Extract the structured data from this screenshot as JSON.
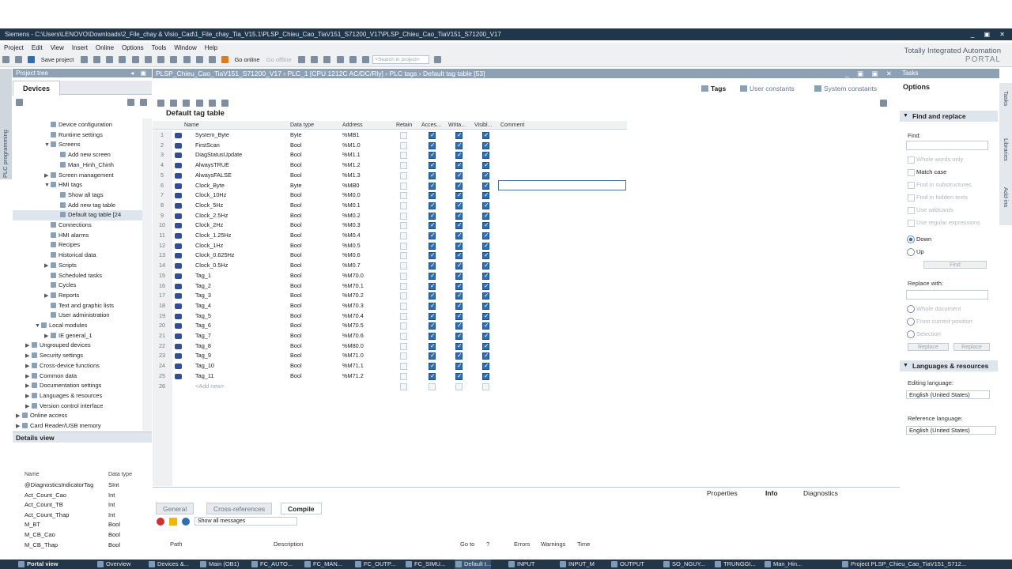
{
  "window": {
    "title": "Siemens  -  C:\\Users\\LENOVO\\Downloads\\2_File_chay & Visio_Cad\\1_File_chay_Tia_V15.1\\PLSP_Chieu_Cao_TiaV151_S71200_V17\\PLSP_Chieu_Cao_TiaV151_S71200_V17"
  },
  "menu": [
    "Project",
    "Edit",
    "View",
    "Insert",
    "Online",
    "Options",
    "Tools",
    "Window",
    "Help"
  ],
  "toolbar": {
    "save": "Save project",
    "go_online": "Go online",
    "go_offline": "Go offline",
    "search_placeholder": "<Search in project>"
  },
  "brand": {
    "line1": "Totally Integrated Automation",
    "line2": "PORTAL"
  },
  "project_tree": {
    "header": "Project tree",
    "tab": "Devices",
    "side_label": "PLC programming",
    "items": [
      {
        "label": "Device configuration",
        "indent": 3,
        "arrow": ""
      },
      {
        "label": "Runtime settings",
        "indent": 3,
        "arrow": ""
      },
      {
        "label": "Screens",
        "indent": 3,
        "arrow": "▼"
      },
      {
        "label": "Add new screen",
        "indent": 4,
        "arrow": ""
      },
      {
        "label": "Man_Hinh_Chinh",
        "indent": 4,
        "arrow": ""
      },
      {
        "label": "Screen management",
        "indent": 3,
        "arrow": "▶"
      },
      {
        "label": "HMI tags",
        "indent": 3,
        "arrow": "▼"
      },
      {
        "label": "Show all tags",
        "indent": 4,
        "arrow": ""
      },
      {
        "label": "Add new tag table",
        "indent": 4,
        "arrow": ""
      },
      {
        "label": "Default tag table [24",
        "indent": 4,
        "arrow": "",
        "selected": true
      },
      {
        "label": "Connections",
        "indent": 3,
        "arrow": ""
      },
      {
        "label": "HMI alarms",
        "indent": 3,
        "arrow": ""
      },
      {
        "label": "Recipes",
        "indent": 3,
        "arrow": ""
      },
      {
        "label": "Historical data",
        "indent": 3,
        "arrow": ""
      },
      {
        "label": "Scripts",
        "indent": 3,
        "arrow": "▶"
      },
      {
        "label": "Scheduled tasks",
        "indent": 3,
        "arrow": ""
      },
      {
        "label": "Cycles",
        "indent": 3,
        "arrow": ""
      },
      {
        "label": "Reports",
        "indent": 3,
        "arrow": "▶"
      },
      {
        "label": "Text and graphic lists",
        "indent": 3,
        "arrow": ""
      },
      {
        "label": "User administration",
        "indent": 3,
        "arrow": ""
      },
      {
        "label": "Local modules",
        "indent": 2,
        "arrow": "▼"
      },
      {
        "label": "IE general_1",
        "indent": 3,
        "arrow": "▶"
      },
      {
        "label": "Ungrouped devices",
        "indent": 1,
        "arrow": "▶"
      },
      {
        "label": "Security settings",
        "indent": 1,
        "arrow": "▶"
      },
      {
        "label": "Cross-device functions",
        "indent": 1,
        "arrow": "▶"
      },
      {
        "label": "Common data",
        "indent": 1,
        "arrow": "▶"
      },
      {
        "label": "Documentation settings",
        "indent": 1,
        "arrow": "▶"
      },
      {
        "label": "Languages & resources",
        "indent": 1,
        "arrow": "▶"
      },
      {
        "label": "Version control interface",
        "indent": 1,
        "arrow": "▶"
      },
      {
        "label": "Online access",
        "indent": 0,
        "arrow": "▶"
      },
      {
        "label": "Card Reader/USB memory",
        "indent": 0,
        "arrow": "▶"
      }
    ]
  },
  "details": {
    "header": "Details view",
    "col_name": "Name",
    "col_type": "Data type",
    "rows": [
      {
        "name": "@DiagnosticsIndicatorTag",
        "type": "SInt"
      },
      {
        "name": "Act_Count_Cao",
        "type": "Int"
      },
      {
        "name": "Act_Count_TB",
        "type": "Int"
      },
      {
        "name": "Act_Count_Thap",
        "type": "Int"
      },
      {
        "name": "M_BT",
        "type": "Bool"
      },
      {
        "name": "M_CB_Cao",
        "type": "Bool"
      },
      {
        "name": "M_CB_Thap",
        "type": "Bool"
      }
    ]
  },
  "editor": {
    "breadcrumb": "PLSP_Chieu_Cao_TiaV151_S71200_V17  ›  PLC_1 [CPU 1212C AC/DC/Rly]  ›  PLC tags  ›  Default tag table [53]",
    "tabs": [
      "Tags",
      "User constants",
      "System constants"
    ],
    "table_title": "Default tag table",
    "columns": [
      "Name",
      "Data type",
      "Address",
      "Retain",
      "Acces...",
      "Writa...",
      "Visibl...",
      "Comment"
    ],
    "rows": [
      {
        "n": "1",
        "name": "System_Byte",
        "type": "Byte",
        "addr": "%MB1"
      },
      {
        "n": "2",
        "name": "FirstScan",
        "type": "Bool",
        "addr": "%M1.0"
      },
      {
        "n": "3",
        "name": "DiagStatusUpdate",
        "type": "Bool",
        "addr": "%M1.1"
      },
      {
        "n": "4",
        "name": "AlwaysTRUE",
        "type": "Bool",
        "addr": "%M1.2"
      },
      {
        "n": "5",
        "name": "AlwaysFALSE",
        "type": "Bool",
        "addr": "%M1.3"
      },
      {
        "n": "6",
        "name": "Clock_Byte",
        "type": "Byte",
        "addr": "%MB0"
      },
      {
        "n": "7",
        "name": "Clock_10Hz",
        "type": "Bool",
        "addr": "%M0.0"
      },
      {
        "n": "8",
        "name": "Clock_5Hz",
        "type": "Bool",
        "addr": "%M0.1"
      },
      {
        "n": "9",
        "name": "Clock_2.5Hz",
        "type": "Bool",
        "addr": "%M0.2"
      },
      {
        "n": "10",
        "name": "Clock_2Hz",
        "type": "Bool",
        "addr": "%M0.3"
      },
      {
        "n": "11",
        "name": "Clock_1.25Hz",
        "type": "Bool",
        "addr": "%M0.4"
      },
      {
        "n": "12",
        "name": "Clock_1Hz",
        "type": "Bool",
        "addr": "%M0.5"
      },
      {
        "n": "13",
        "name": "Clock_0.625Hz",
        "type": "Bool",
        "addr": "%M0.6"
      },
      {
        "n": "14",
        "name": "Clock_0.5Hz",
        "type": "Bool",
        "addr": "%M0.7"
      },
      {
        "n": "15",
        "name": "Tag_1",
        "type": "Bool",
        "addr": "%M70.0"
      },
      {
        "n": "16",
        "name": "Tag_2",
        "type": "Bool",
        "addr": "%M70.1"
      },
      {
        "n": "17",
        "name": "Tag_3",
        "type": "Bool",
        "addr": "%M70.2"
      },
      {
        "n": "18",
        "name": "Tag_4",
        "type": "Bool",
        "addr": "%M70.3"
      },
      {
        "n": "19",
        "name": "Tag_5",
        "type": "Bool",
        "addr": "%M70.4"
      },
      {
        "n": "20",
        "name": "Tag_6",
        "type": "Bool",
        "addr": "%M70.5"
      },
      {
        "n": "21",
        "name": "Tag_7",
        "type": "Bool",
        "addr": "%M70.6"
      },
      {
        "n": "22",
        "name": "Tag_8",
        "type": "Bool",
        "addr": "%M80.0"
      },
      {
        "n": "23",
        "name": "Tag_9",
        "type": "Bool",
        "addr": "%M71.0"
      },
      {
        "n": "24",
        "name": "Tag_10",
        "type": "Bool",
        "addr": "%M71.1"
      },
      {
        "n": "25",
        "name": "Tag_11",
        "type": "Bool",
        "addr": "%M71.2"
      }
    ],
    "new_row": {
      "n": "26",
      "name": "<Add new>"
    }
  },
  "tasks": {
    "header": "Tasks",
    "options": "Options",
    "find_replace": "Find and replace",
    "find": "Find:",
    "whole_words": "Whole words only",
    "match_case": "Match case",
    "substructures": "Find in substructures",
    "hidden": "Find in hidden texts",
    "wildcards": "Use wildcards",
    "regex": "Use regular expressions",
    "down": "Down",
    "up": "Up",
    "find_btn": "Find",
    "replace_with": "Replace with:",
    "whole_doc": "Whole document",
    "from_current": "From current position",
    "selection": "Selection",
    "replace_btn": "Replace",
    "replace_all_btn": "Replace",
    "languages": "Languages & resources",
    "editing_lang": "Editing language:",
    "editing_val": "English (United States)",
    "ref_lang": "Reference language:",
    "ref_val": "English (United States)",
    "vtabs": [
      "Tasks",
      "Libraries",
      "Add-ins"
    ]
  },
  "inspector": {
    "properties": "Properties",
    "info": "Info",
    "diagnostics": "Diagnostics",
    "tabs": [
      "General",
      "Cross-references",
      "Compile"
    ],
    "filter": "Show all messages",
    "cols": [
      "Path",
      "Description",
      "Go to",
      "?",
      "Errors",
      "Warnings",
      "Time"
    ]
  },
  "taskbar": {
    "portal": "Portal view",
    "items": [
      "Overview",
      "Devices &...",
      "Main (OB1)",
      "FC_AUTO...",
      "FC_MAN...",
      "FC_OUTP...",
      "FC_SIMU...",
      "Default t...",
      "INPUT",
      "INPUT_M",
      "OUTPUT",
      "SO_NGUY...",
      "TRUNGGI...",
      "Man_Hin..."
    ],
    "project": "Project PLSP_Chieu_Cao_TiaV151_S712..."
  }
}
